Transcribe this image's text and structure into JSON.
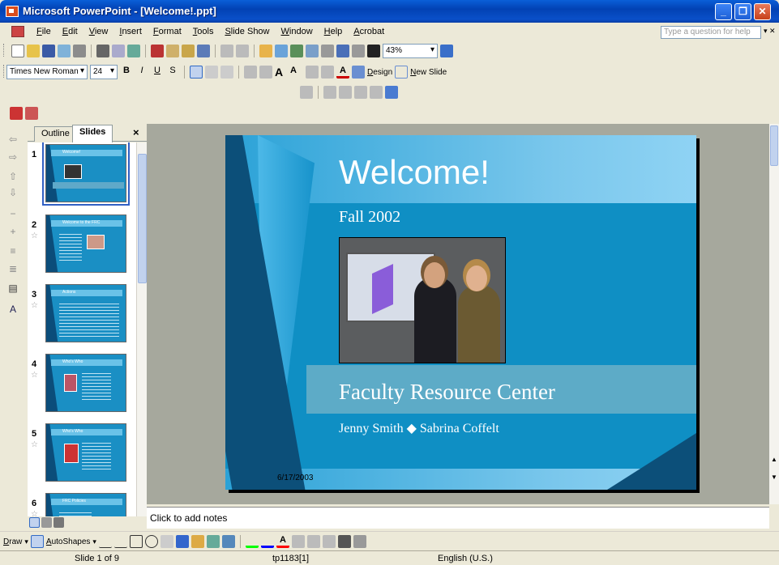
{
  "window": {
    "title": "Microsoft PowerPoint - [Welcome!.ppt]"
  },
  "menu": {
    "items": [
      "File",
      "Edit",
      "View",
      "Insert",
      "Format",
      "Tools",
      "Slide Show",
      "Window",
      "Help",
      "Acrobat"
    ],
    "help_placeholder": "Type a question for help"
  },
  "standard_toolbar": {
    "zoom": "43%"
  },
  "formatting_toolbar": {
    "font": "Times New Roman",
    "size": "24",
    "design_label": "Design",
    "new_slide_label": "New Slide"
  },
  "pane": {
    "tabs": [
      "Outline",
      "Slides"
    ],
    "slide_numbers": [
      "1",
      "2",
      "3",
      "4",
      "5",
      "6"
    ],
    "thumb_titles": [
      "Welcome!",
      "Welcome to the FRC",
      "Actions",
      "Who's Who",
      "Who's Who",
      "FRC Policies"
    ]
  },
  "slide": {
    "title": "Welcome!",
    "subtitle": "Fall 2002",
    "band_title": "Faculty Resource Center",
    "names": "Jenny Smith ◆ Sabrina Coffelt",
    "date": "6/17/2003"
  },
  "notes": {
    "placeholder": "Click to add notes"
  },
  "drawing_toolbar": {
    "draw_label": "Draw",
    "autoshapes_label": "AutoShapes"
  },
  "status": {
    "slide_position": "Slide 1 of 9",
    "design_name": "tp1183[1]",
    "language": "English (U.S.)"
  },
  "colors": {
    "titlebar": "#0a5fd8",
    "slide_bg": "#0f8fc4",
    "slide_dark": "#0c4f79"
  }
}
